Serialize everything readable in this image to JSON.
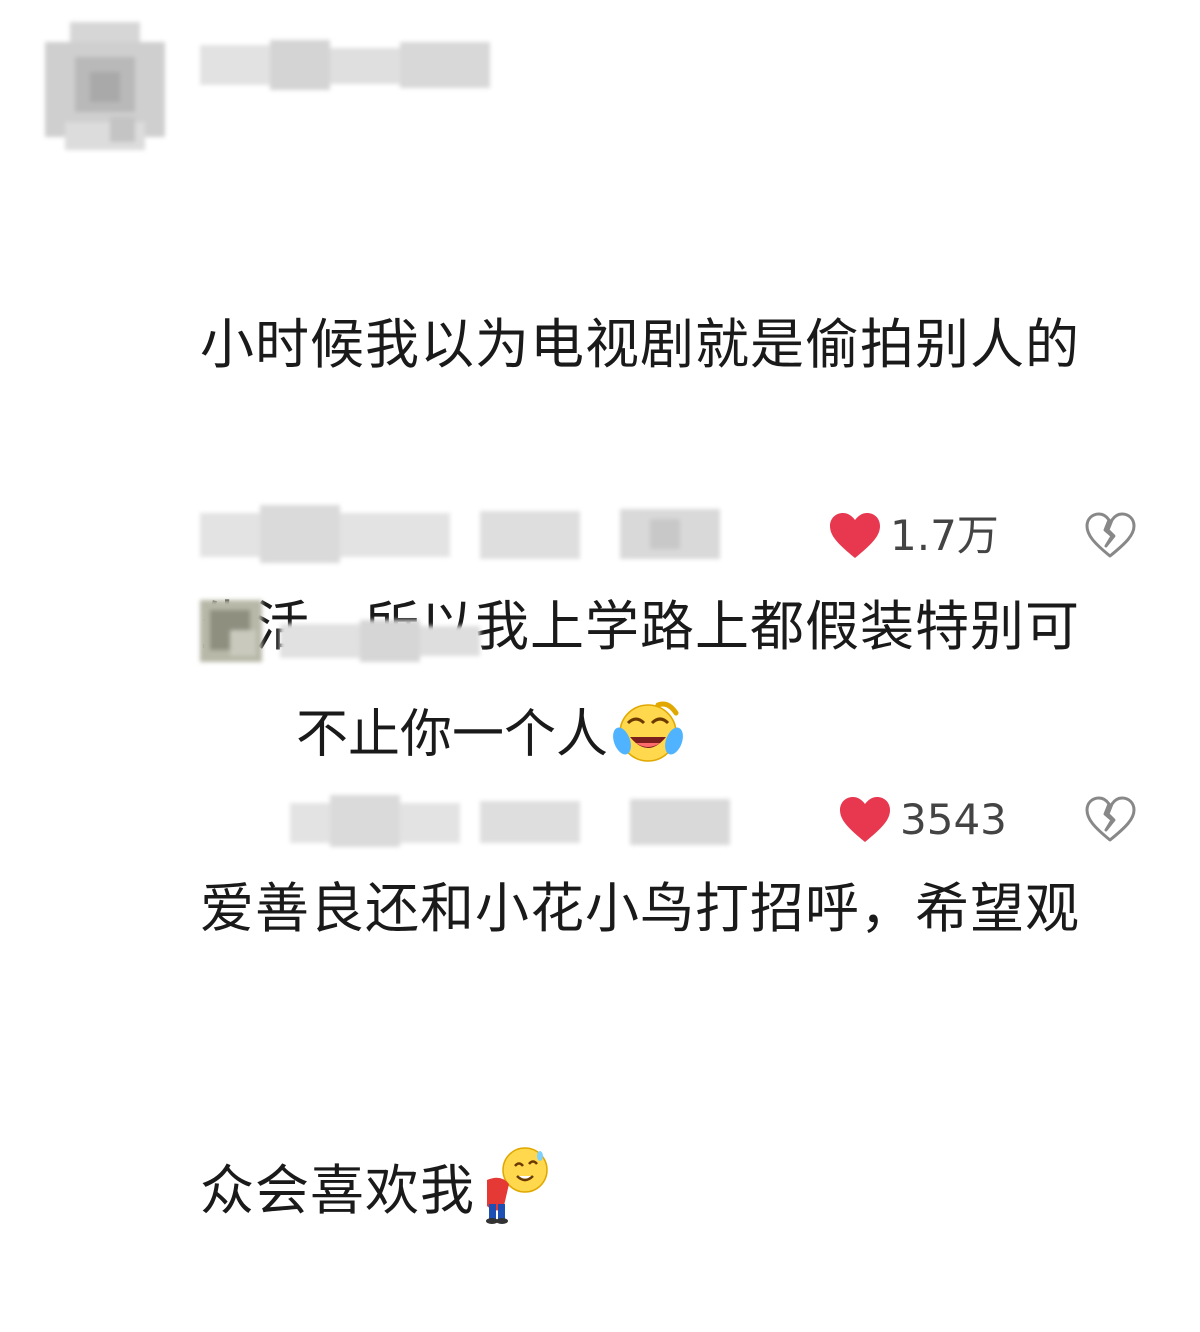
{
  "comment": {
    "text_line1": "小时候我以为电视剧就是偷拍别人的",
    "text_line2": "生活，所以我上学路上都假装特别可",
    "text_line3": "爱善良还和小花小鸟打招呼，希望观",
    "text_line4": "众会喜欢我",
    "emoji": "bowing-face-emoji",
    "like_count": "1.7万",
    "like_icon": "heart-icon",
    "dislike_icon": "broken-heart-icon"
  },
  "reply": {
    "text": "不止你一个人",
    "emoji": "crying-laughing-face-emoji",
    "like_count": "3543",
    "like_icon": "heart-icon",
    "dislike_icon": "broken-heart-icon"
  },
  "colors": {
    "heart": "#e8384f",
    "text": "#1a1a1a",
    "count": "#444444",
    "broken_heart": "#888888"
  }
}
